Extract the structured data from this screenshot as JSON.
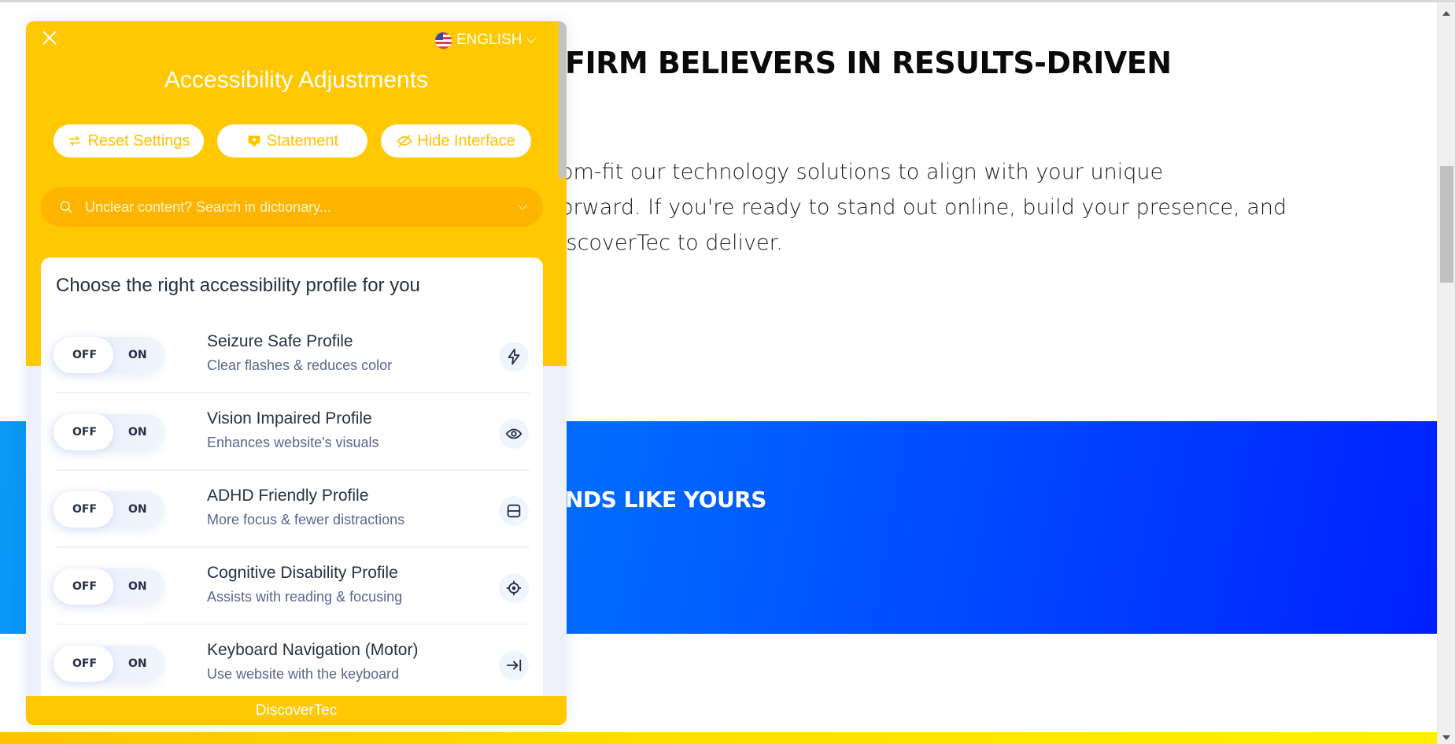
{
  "page": {
    "heading": "FIRM BELIEVERS IN RESULTS-DRIVEN",
    "body_lines": [
      "om-fit our technology solutions to align with your unique",
      "orward. If you're ready to stand out online, build your presence, and",
      "iscoverTec to deliver."
    ],
    "band_text": "NDS LIKE YOURS",
    "colors": {
      "band_start": "#0a9af5",
      "band_end": "#0020ff",
      "bottom_bar": "#ffe100"
    }
  },
  "panel": {
    "close_icon": "close-icon",
    "language": {
      "label": "ENGLISH",
      "flag": "us-flag-icon"
    },
    "title": "Accessibility Adjustments",
    "actions": [
      {
        "label": "Reset Settings",
        "icon": "reset-icon"
      },
      {
        "label": "Statement",
        "icon": "statement-icon"
      },
      {
        "label": "Hide Interface",
        "icon": "eye-slash-icon"
      }
    ],
    "search": {
      "placeholder": "Unclear content? Search in dictionary...",
      "value": ""
    },
    "profiles_heading": "Choose the right accessibility profile for you",
    "toggle_labels": {
      "off": "OFF",
      "on": "ON"
    },
    "profiles": [
      {
        "title": "Seizure Safe Profile",
        "desc": "Clear flashes & reduces color",
        "icon": "bolt-icon",
        "state": "OFF"
      },
      {
        "title": "Vision Impaired Profile",
        "desc": "Enhances website's visuals",
        "icon": "eye-icon",
        "state": "OFF"
      },
      {
        "title": "ADHD Friendly Profile",
        "desc": "More focus & fewer distractions",
        "icon": "focus-icon",
        "state": "OFF"
      },
      {
        "title": "Cognitive Disability Profile",
        "desc": "Assists with reading & focusing",
        "icon": "target-icon",
        "state": "OFF"
      },
      {
        "title": "Keyboard Navigation (Motor)",
        "desc": "Use website with the keyboard",
        "icon": "arrow-to-line-icon",
        "state": "OFF"
      }
    ],
    "footer": "DiscoverTec",
    "colors": {
      "accent": "#ffc800",
      "search_bg": "#ffb400",
      "text_dark": "#2a2f45",
      "text_muted": "#5b6690"
    }
  }
}
